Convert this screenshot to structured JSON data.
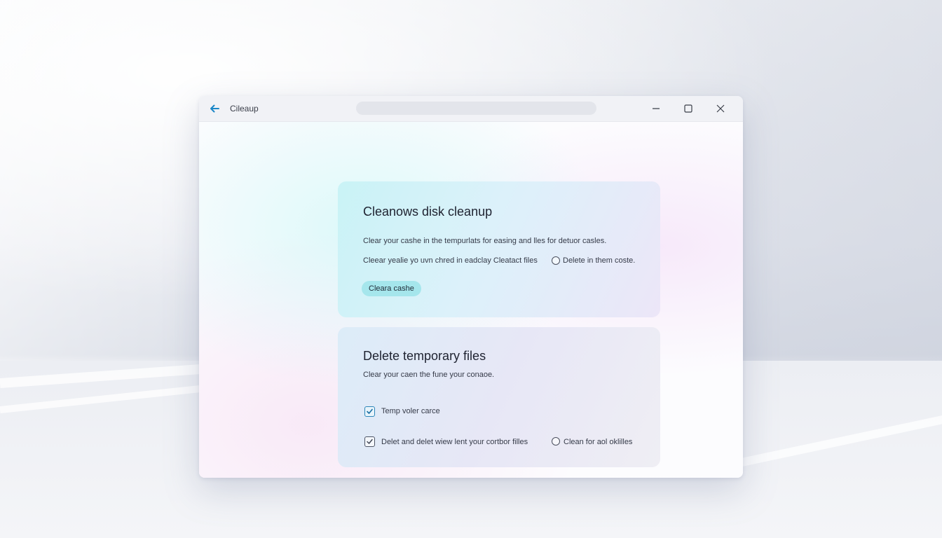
{
  "window": {
    "title": "Cileaup"
  },
  "card1": {
    "heading": "Cleanows disk cleanup",
    "description": "Clear your cashe in the tempurlats for easing and lles for detuor casles.",
    "option_text": "Cleear yealie yo uvn chred in eadclay Cleatact files",
    "radio_label": "Delete in them coste.",
    "button_label": "Cleara cashe"
  },
  "card2": {
    "heading": "Delete temporary files",
    "description": "Clear your caen the fune your conaoe.",
    "checkbox1_label": "Temp voler carce",
    "checkbox1_checked": true,
    "checkbox2_label": "Delet and delet wiew lent your cortbor filles",
    "checkbox2_checked": true,
    "radio_label": "Clean for aol oklilles"
  },
  "colors": {
    "accent": "#1a86c7",
    "button_bg": "#a5e6ec"
  },
  "icons": [
    "back-arrow-icon",
    "minimize-icon",
    "maximize-icon",
    "close-icon",
    "checkmark-icon"
  ]
}
